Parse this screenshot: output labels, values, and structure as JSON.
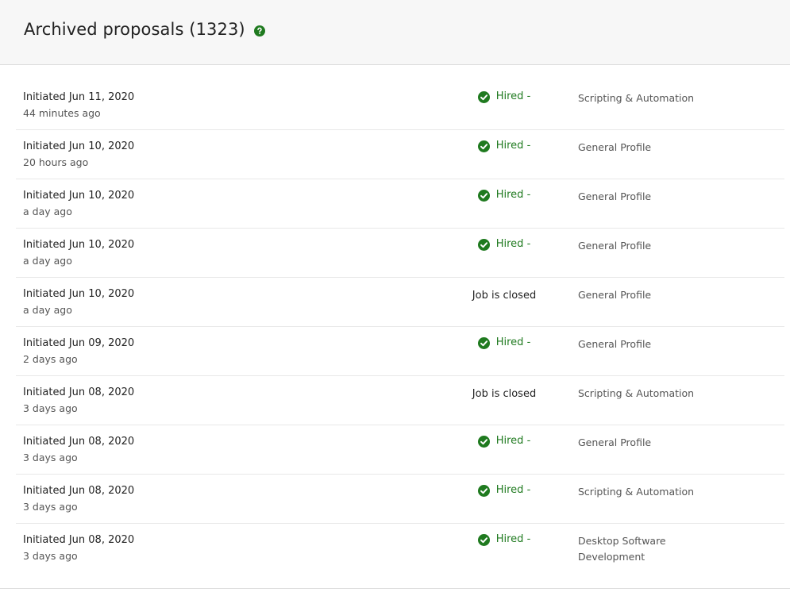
{
  "header": {
    "title": "Archived proposals (1323)",
    "help_icon": "question-circle-icon",
    "accent_color": "#1f7a1f"
  },
  "proposals": [
    {
      "initiated": "Initiated Jun 11, 2020",
      "ago": "44 minutes ago",
      "status": "hired",
      "status_label": "Hired -",
      "profile": "Scripting & Automation"
    },
    {
      "initiated": "Initiated Jun 10, 2020",
      "ago": "20 hours ago",
      "status": "hired",
      "status_label": "Hired -",
      "profile": "General Profile"
    },
    {
      "initiated": "Initiated Jun 10, 2020",
      "ago": "a day ago",
      "status": "hired",
      "status_label": "Hired -",
      "profile": "General Profile"
    },
    {
      "initiated": "Initiated Jun 10, 2020",
      "ago": "a day ago",
      "status": "hired",
      "status_label": "Hired -",
      "profile": "General Profile"
    },
    {
      "initiated": "Initiated Jun 10, 2020",
      "ago": "a day ago",
      "status": "closed",
      "status_label": "Job is closed",
      "profile": "General Profile"
    },
    {
      "initiated": "Initiated Jun 09, 2020",
      "ago": "2 days ago",
      "status": "hired",
      "status_label": "Hired -",
      "profile": "General Profile"
    },
    {
      "initiated": "Initiated Jun 08, 2020",
      "ago": "3 days ago",
      "status": "closed",
      "status_label": "Job is closed",
      "profile": "Scripting & Automation"
    },
    {
      "initiated": "Initiated Jun 08, 2020",
      "ago": "3 days ago",
      "status": "hired",
      "status_label": "Hired -",
      "profile": "General Profile"
    },
    {
      "initiated": "Initiated Jun 08, 2020",
      "ago": "3 days ago",
      "status": "hired",
      "status_label": "Hired -",
      "profile": "Scripting & Automation"
    },
    {
      "initiated": "Initiated Jun 08, 2020",
      "ago": "3 days ago",
      "status": "hired",
      "status_label": "Hired -",
      "profile": "Desktop Software Development"
    }
  ]
}
